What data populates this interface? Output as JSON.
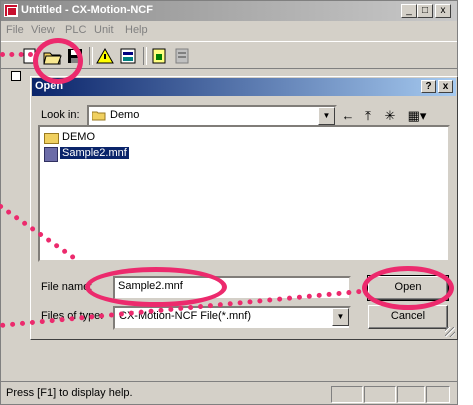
{
  "window": {
    "title": "Untitled - CX-Motion-NCF",
    "controls": {
      "minimize": "_",
      "maximize": "□",
      "close": "x"
    }
  },
  "menu": [
    "File",
    "View",
    "PLC",
    "Unit",
    "Help"
  ],
  "toolbar": {
    "buttons": [
      "new-file-icon",
      "open-folder-icon",
      "save-icon",
      "alert-icon",
      "view-icon",
      "unit-icon",
      "print-icon"
    ]
  },
  "dialog": {
    "title": "Open",
    "help_button": "?",
    "close_button": "x",
    "look_in_label": "Look in:",
    "look_in_value": "Demo",
    "files": [
      {
        "name": "DEMO",
        "type": "folder",
        "selected": false
      },
      {
        "name": "Sample2.mnf",
        "type": "mnf",
        "selected": true
      }
    ],
    "file_name_label": "File name:",
    "file_name_value": "Sample2.mnf",
    "file_type_label": "Files of type:",
    "file_type_value": "CX-Motion-NCF File(*.mnf)",
    "open_button": "Open",
    "cancel_button": "Cancel"
  },
  "status": {
    "text": "Press [F1] to display help."
  },
  "annotations": {
    "color": "#ec2a6d"
  }
}
